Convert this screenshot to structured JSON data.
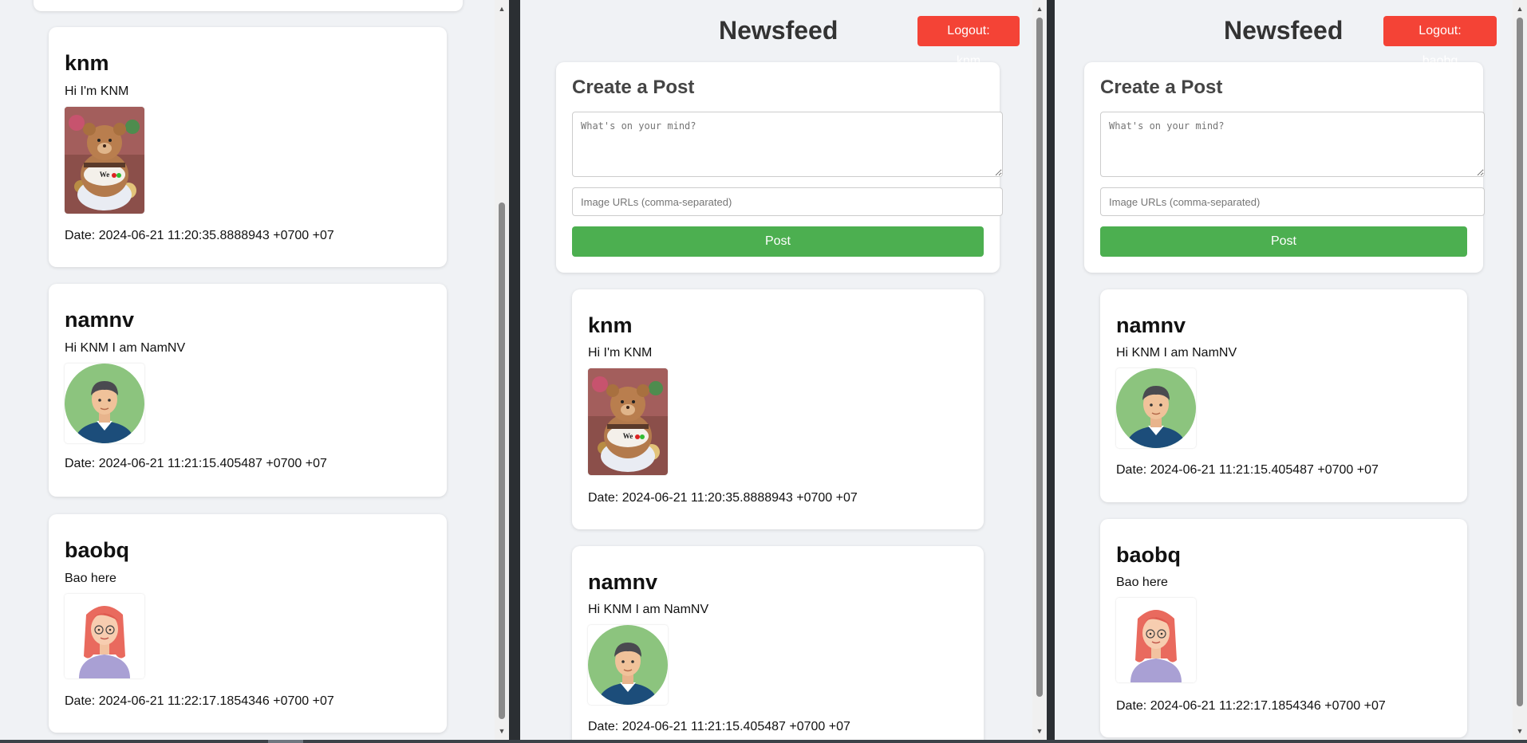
{
  "panes": [
    {
      "posts": [
        {
          "author": "knm",
          "content": "Hi I'm KNM",
          "image": "teddy-bear",
          "date": "Date: 2024-06-21 11:20:35.8888943 +0700 +07"
        },
        {
          "author": "namnv",
          "content": "Hi KNM I am NamNV",
          "image": "male-avatar",
          "date": "Date: 2024-06-21 11:21:15.405487 +0700 +07"
        },
        {
          "author": "baobq",
          "content": "Bao here",
          "image": "female-avatar",
          "date": "Date: 2024-06-21 11:22:17.1854346 +0700 +07"
        }
      ]
    },
    {
      "header": {
        "title": "Newsfeed",
        "logout_label": "Logout: knm"
      },
      "create": {
        "title": "Create a Post",
        "content_placeholder": "What's on your mind?",
        "images_placeholder": "Image URLs (comma-separated)",
        "post_label": "Post"
      },
      "posts": [
        {
          "author": "knm",
          "content": "Hi I'm KNM",
          "image": "teddy-bear",
          "date": "Date: 2024-06-21 11:20:35.8888943 +0700 +07"
        },
        {
          "author": "namnv",
          "content": "Hi KNM I am NamNV",
          "image": "male-avatar",
          "date": "Date: 2024-06-21 11:21:15.405487 +0700 +07"
        }
      ]
    },
    {
      "header": {
        "title": "Newsfeed",
        "logout_label": "Logout: baobq"
      },
      "create": {
        "title": "Create a Post",
        "content_placeholder": "What's on your mind?",
        "images_placeholder": "Image URLs (comma-separated)",
        "post_label": "Post"
      },
      "posts": [
        {
          "author": "namnv",
          "content": "Hi KNM I am NamNV",
          "image": "male-avatar",
          "date": "Date: 2024-06-21 11:21:15.405487 +0700 +07"
        },
        {
          "author": "baobq",
          "content": "Bao here",
          "image": "female-avatar",
          "date": "Date: 2024-06-21 11:22:17.1854346 +0700 +07"
        }
      ]
    }
  ],
  "colors": {
    "page_bg": "#f0f2f5",
    "logout": "#f44336",
    "post_button": "#4caf50"
  }
}
